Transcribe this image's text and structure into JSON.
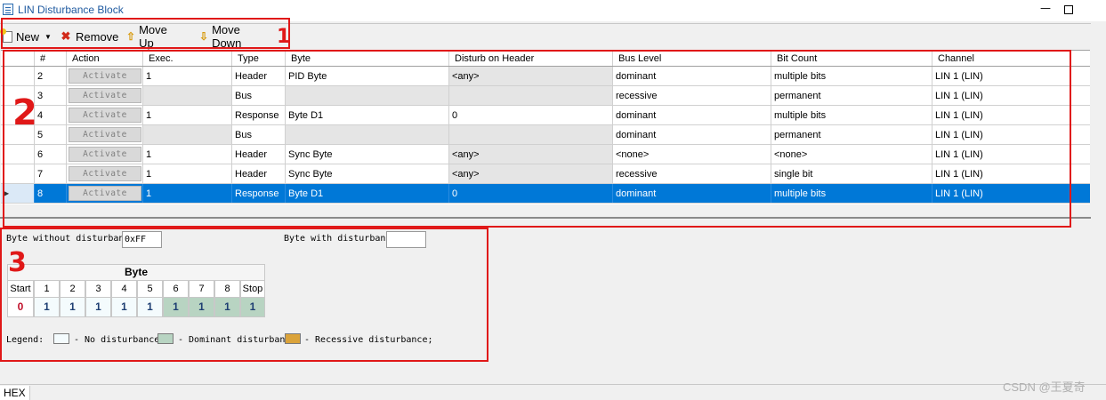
{
  "window": {
    "title": "LIN Disturbance Block"
  },
  "toolbar": {
    "new_label": "New",
    "remove_label": "Remove",
    "move_up_label": "Move Up",
    "move_down_label": "Move Down",
    "new_icon": "new-document-icon",
    "remove_icon": "remove-x-icon",
    "move_up_icon": "arrow-up-icon",
    "move_down_icon": "arrow-down-icon"
  },
  "annotations": {
    "n1": "1",
    "n2": "2",
    "n3": "3",
    "color": "#e01818"
  },
  "table": {
    "headers": [
      "#",
      "Action",
      "Exec.",
      "Type",
      "Byte",
      "Disturb on Header",
      "Bus Level",
      "Bit Count",
      "Channel"
    ],
    "rows": [
      {
        "num": "2",
        "action": "Activate",
        "exec": "1",
        "type": "Header",
        "byte": "PID Byte",
        "disturb": "<any>",
        "bus": "dominant",
        "bits": "multiple bits",
        "channel": "LIN 1 (LIN)"
      },
      {
        "num": "3",
        "action": "Activate",
        "exec": "",
        "type": "Bus",
        "byte": "",
        "disturb": "",
        "bus": "recessive",
        "bits": "permanent",
        "channel": "LIN 1 (LIN)"
      },
      {
        "num": "4",
        "action": "Activate",
        "exec": "1",
        "type": "Response",
        "byte": "Byte D1",
        "disturb": "0",
        "bus": "dominant",
        "bits": "multiple bits",
        "channel": "LIN 1 (LIN)"
      },
      {
        "num": "5",
        "action": "Activate",
        "exec": "",
        "type": "Bus",
        "byte": "",
        "disturb": "",
        "bus": "dominant",
        "bits": "permanent",
        "channel": "LIN 1 (LIN)"
      },
      {
        "num": "6",
        "action": "Activate",
        "exec": "1",
        "type": "Header",
        "byte": "Sync Byte",
        "disturb": "<any>",
        "bus": "<none>",
        "bits": "<none>",
        "channel": "LIN 1 (LIN)"
      },
      {
        "num": "7",
        "action": "Activate",
        "exec": "1",
        "type": "Header",
        "byte": "Sync Byte",
        "disturb": "<any>",
        "bus": "recessive",
        "bits": "single bit",
        "channel": "LIN 1 (LIN)"
      },
      {
        "num": "8",
        "action": "Activate",
        "exec": "1",
        "type": "Response",
        "byte": "Byte D1",
        "disturb": "0",
        "bus": "dominant",
        "bits": "multiple bits",
        "channel": "LIN 1 (LIN)"
      }
    ],
    "selected_row": "8",
    "selection_color": "#0078d7"
  },
  "byte_panel": {
    "without_label": "Byte without disturbance",
    "without_value": "0xFF",
    "with_label": "Byte with disturbance",
    "with_value": "",
    "table_title": "Byte",
    "bit_headers": [
      "Start",
      "1",
      "2",
      "3",
      "4",
      "5",
      "6",
      "7",
      "8",
      "Stop"
    ],
    "bit_values": [
      "0",
      "1",
      "1",
      "1",
      "1",
      "1",
      "1",
      "1",
      "1",
      "1"
    ],
    "legend_label": "Legend:",
    "legend_none": "- No disturbance",
    "legend_dominant": "- Dominant disturbance",
    "legend_recessive": "- Recessive disturbance;",
    "colors": {
      "none": "#f4fbfd",
      "dominant": "#b8d4c2",
      "recessive": "#dba33a"
    }
  },
  "status": {
    "hex_tab": "HEX"
  },
  "watermark": "CSDN @王夏奇"
}
